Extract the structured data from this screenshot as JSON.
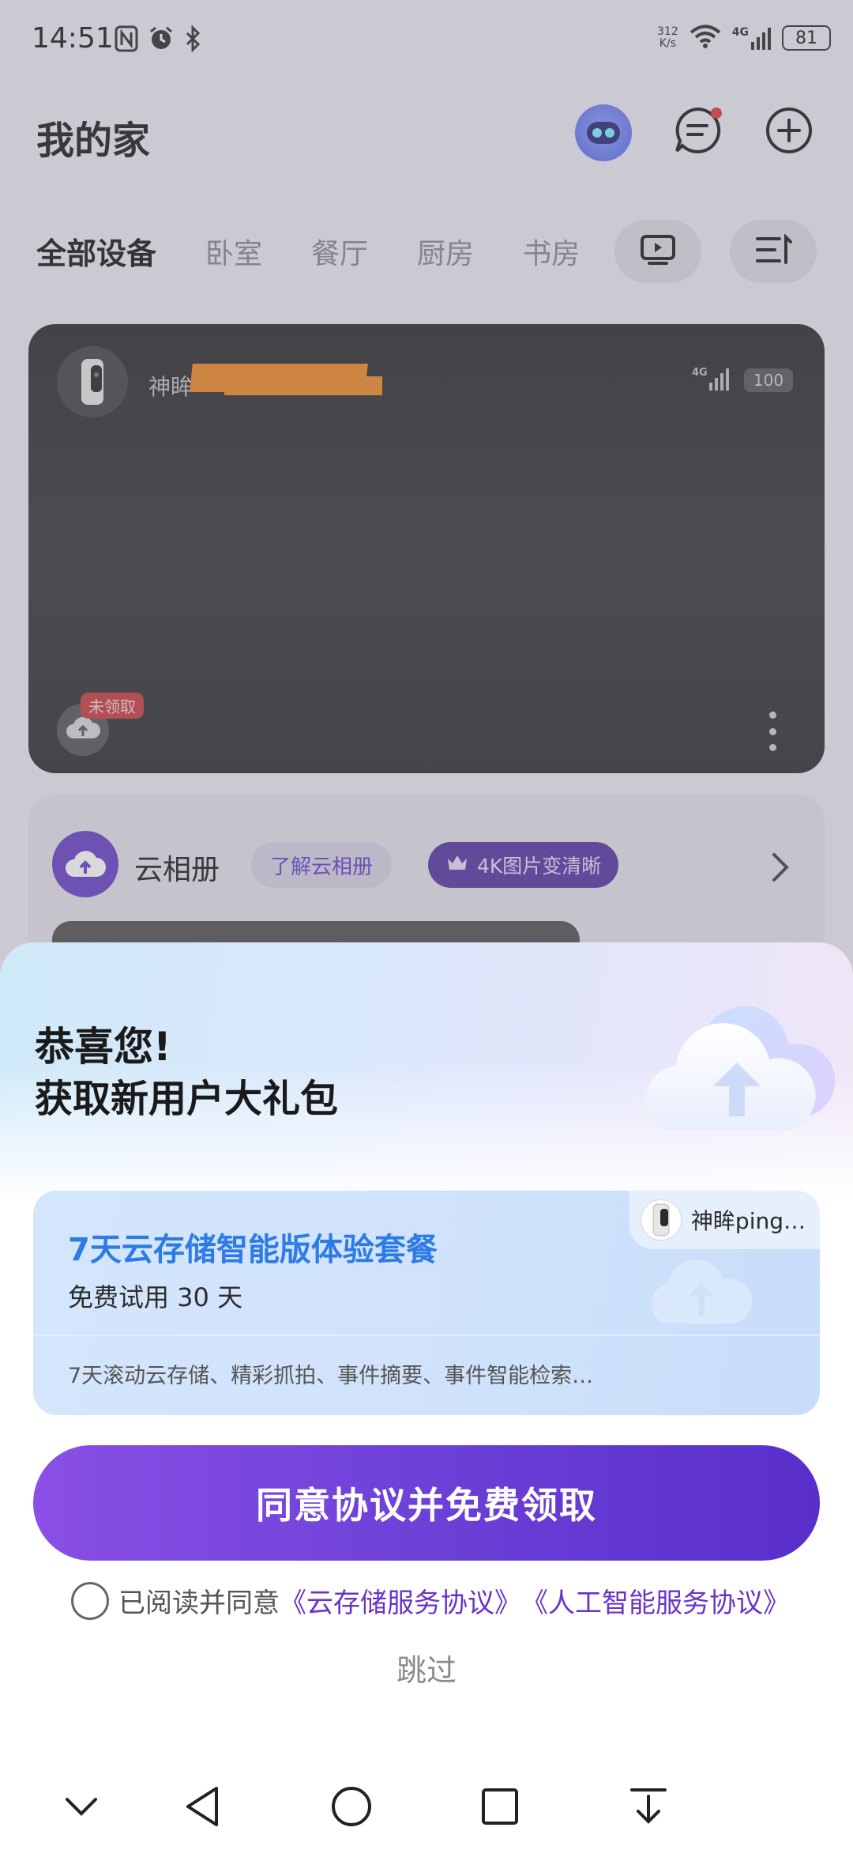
{
  "status_bar": {
    "time": "14:51",
    "net_speed_value": "312",
    "net_speed_unit": "K/s",
    "network_type": "4G",
    "battery": "81"
  },
  "header": {
    "title": "我的家"
  },
  "tabs": [
    {
      "label": "全部设备",
      "active": true
    },
    {
      "label": "卧室",
      "active": false
    },
    {
      "label": "餐厅",
      "active": false
    },
    {
      "label": "厨房",
      "active": false
    },
    {
      "label": "书房",
      "active": false
    }
  ],
  "camera_card": {
    "device_name": "神眸",
    "network_type": "4G",
    "battery": "100",
    "cloud_badge": "未领取"
  },
  "cloud_album": {
    "title": "云相册",
    "learn_label": "了解云相册",
    "enhance_label": "4K图片变清晰"
  },
  "sheet": {
    "title_line1": "恭喜您!",
    "title_line2": "获取新用户大礼包",
    "package": {
      "device_name": "神眸ping…",
      "title": "7天云存储智能版体验套餐",
      "subtitle": "免费试用 30 天",
      "description": "7天滚动云存储、精彩抓拍、事件摘要、事件智能检索…"
    },
    "claim_button": "同意协议并免费领取",
    "agree_prefix": "已阅读并同意",
    "agree_link1": "《云存储服务协议》",
    "agree_link2": "《人工智能服务协议》",
    "skip_label": "跳过"
  },
  "colors": {
    "accent_purple": "#6a3fd6",
    "link_purple": "#6a34c8",
    "package_title_blue": "#2e7be6",
    "badge_red": "#c94040",
    "redaction_orange": "#f08a2a"
  },
  "icons": [
    "nfc-icon",
    "alarm-icon",
    "bluetooth-icon",
    "wifi-icon",
    "signal-icon",
    "robot-assistant-icon",
    "message-icon",
    "add-icon",
    "tv-icon",
    "sort-icon",
    "camera-icon",
    "cloud-upload-icon",
    "more-icon",
    "crown-icon",
    "chevron-right-icon",
    "nav-down-icon",
    "nav-back-icon",
    "nav-home-icon",
    "nav-recents-icon",
    "nav-pulldown-icon"
  ]
}
